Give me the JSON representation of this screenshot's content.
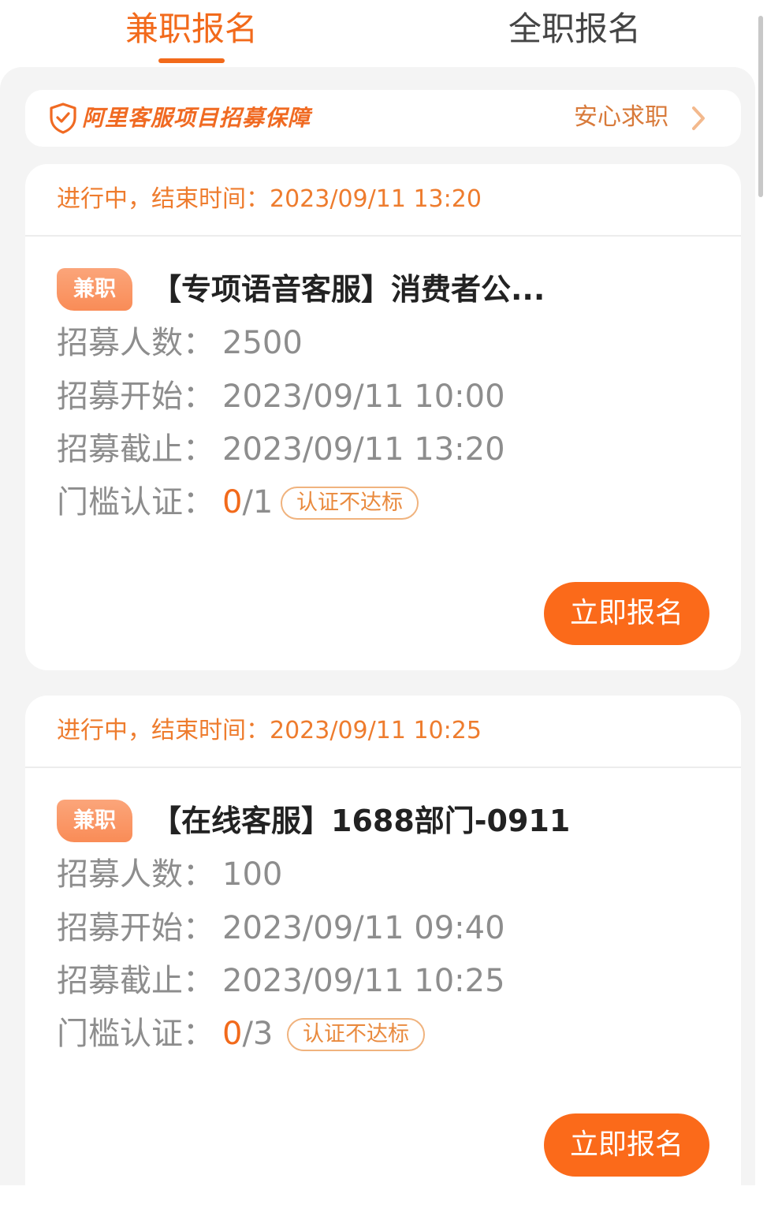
{
  "tabs": [
    {
      "label": "兼职报名",
      "active": true
    },
    {
      "label": "全职报名",
      "active": false
    }
  ],
  "guarantee": {
    "icon": "shield-check-icon",
    "text": "阿里客服项目招募保障",
    "link_label": "安心求职",
    "link_icon": "chevron-right-icon"
  },
  "colors": {
    "accent": "#f26a1b",
    "button": "#fb6a1a",
    "background": "#f4f4f4"
  },
  "jobs": [
    {
      "status": "进行中，结束时间：2023/09/11 13:20",
      "tag": "兼职",
      "title": "【专项语音客服】消费者公...",
      "fields": {
        "count_label": "招募人数：",
        "count_value": "2500",
        "start_label": "招募开始：",
        "start_value": "2023/09/11 10:00",
        "end_label": "招募截止：",
        "end_value": "2023/09/11 13:20",
        "cert_label": "门槛认证：",
        "cert_done": "0",
        "cert_total": "/1",
        "cert_badge": "认证不达标"
      },
      "button": "立即报名"
    },
    {
      "status": "进行中，结束时间：2023/09/11 10:25",
      "tag": "兼职",
      "title": "【在线客服】1688部门-0911",
      "fields": {
        "count_label": "招募人数：",
        "count_value": "100",
        "start_label": "招募开始：",
        "start_value": "2023/09/11 09:40",
        "end_label": "招募截止：",
        "end_value": "2023/09/11 10:25",
        "cert_label": "门槛认证：",
        "cert_done": "0",
        "cert_total": "/3",
        "cert_badge": "认证不达标"
      },
      "button": "立即报名"
    }
  ]
}
